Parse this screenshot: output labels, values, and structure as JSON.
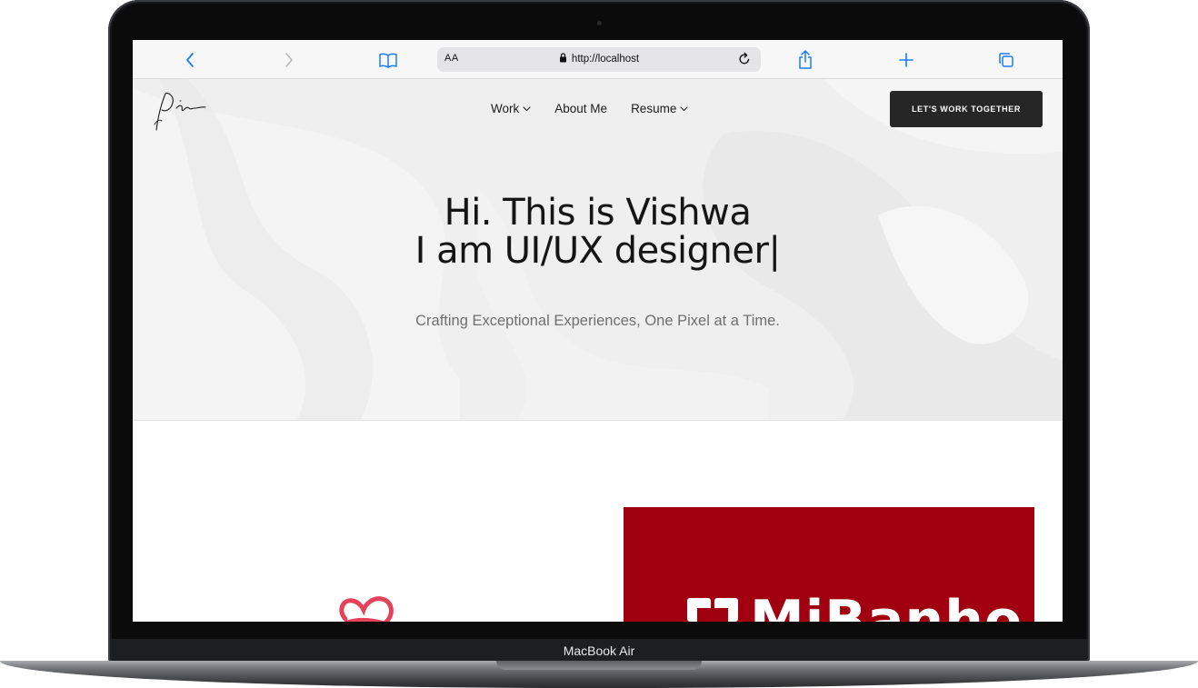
{
  "device": {
    "label": "MacBook Air"
  },
  "browser": {
    "url": "http://localhost",
    "text_size_button": "AA",
    "icons": {
      "back": "chevron-left-icon",
      "forward": "chevron-right-icon",
      "bookmarks": "book-icon",
      "lock": "lock-icon",
      "reload": "reload-icon",
      "share": "share-icon",
      "new_tab": "plus-icon",
      "tabs": "tabs-icon"
    },
    "accent_color": "#1a7cf5"
  },
  "site": {
    "logo_alt": "signature logo",
    "nav": [
      {
        "label": "Work",
        "has_dropdown": true
      },
      {
        "label": "About Me",
        "has_dropdown": false
      },
      {
        "label": "Resume",
        "has_dropdown": true
      }
    ],
    "cta_label": "LET'S WORK TOGETHER",
    "hero": {
      "line1": "Hi. This is Vishwa",
      "line2": "I am UI/UX designer|",
      "subtitle": "Crafting Exceptional Experiences, One Pixel at a Time."
    },
    "projects": [
      {
        "name": "heart logo project",
        "color": "#e5415b"
      },
      {
        "name": "MiBanho",
        "visible_text": "MiBanho",
        "color": "#a0000f"
      }
    ]
  }
}
